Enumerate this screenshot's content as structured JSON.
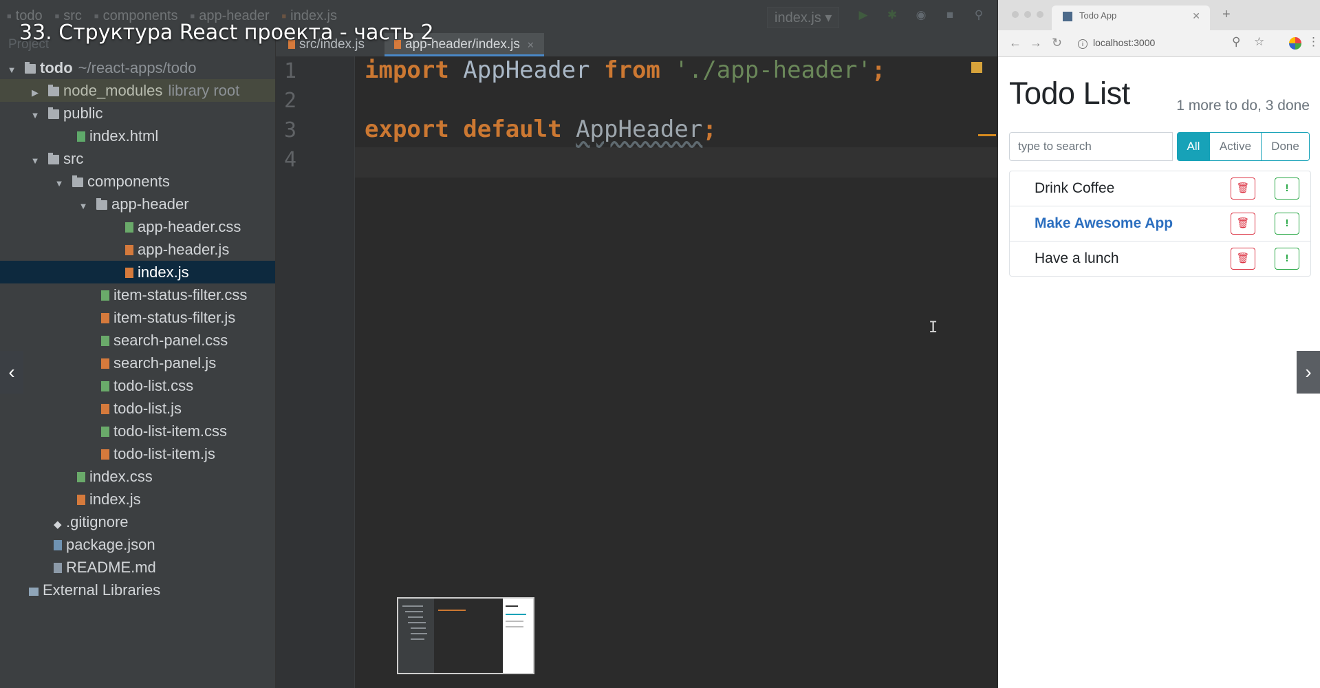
{
  "video": {
    "title": "33. Структура React проекта - часть 2"
  },
  "ide": {
    "breadcrumbs": [
      "todo",
      "src",
      "components",
      "app-header",
      "index.js"
    ],
    "run_config": "index.js ▾",
    "toolbar_icons": [
      "run-icon",
      "debug-icon",
      "coverage-icon",
      "stop-icon",
      "search-icon"
    ],
    "project_panel_title": "Project",
    "tree": [
      {
        "label": "todo",
        "hint": "~/react-apps/todo",
        "icon": "folder-icon"
      },
      {
        "label": "node_modules",
        "hint": "library root",
        "icon": "folder-icon"
      },
      {
        "label": "public",
        "icon": "folder-icon"
      },
      {
        "label": "index.html",
        "icon": "html-file-icon"
      },
      {
        "label": "src",
        "icon": "folder-icon"
      },
      {
        "label": "components",
        "icon": "folder-icon"
      },
      {
        "label": "app-header",
        "icon": "folder-icon"
      },
      {
        "label": "app-header.css",
        "icon": "css-file-icon"
      },
      {
        "label": "app-header.js",
        "icon": "js-file-icon"
      },
      {
        "label": "index.js",
        "icon": "js-file-icon",
        "selected": true
      },
      {
        "label": "item-status-filter.css",
        "icon": "css-file-icon"
      },
      {
        "label": "item-status-filter.js",
        "icon": "js-file-icon"
      },
      {
        "label": "search-panel.css",
        "icon": "css-file-icon"
      },
      {
        "label": "search-panel.js",
        "icon": "js-file-icon"
      },
      {
        "label": "todo-list.css",
        "icon": "css-file-icon"
      },
      {
        "label": "todo-list.js",
        "icon": "js-file-icon"
      },
      {
        "label": "todo-list-item.css",
        "icon": "css-file-icon"
      },
      {
        "label": "todo-list-item.js",
        "icon": "js-file-icon"
      },
      {
        "label": "index.css",
        "icon": "css-file-icon"
      },
      {
        "label": "index.js",
        "icon": "js-file-icon"
      },
      {
        "label": ".gitignore",
        "icon": "gitignore-icon"
      },
      {
        "label": "package.json",
        "icon": "json-file-icon"
      },
      {
        "label": "README.md",
        "icon": "md-file-icon"
      },
      {
        "label": "External Libraries",
        "icon": "external-libraries-icon"
      }
    ],
    "tabs": [
      {
        "label": "src/index.js",
        "active": false
      },
      {
        "label": "app-header/index.js",
        "active": true
      }
    ],
    "line_numbers": [
      "1",
      "2",
      "3",
      "4"
    ],
    "code": {
      "line1": {
        "kw1": "import",
        "name": " AppHeader ",
        "kw2": "from",
        "str": " './app-header'",
        "semi": ";"
      },
      "line3": {
        "kw1": "export",
        "kw2": " default",
        "name": "AppHeader",
        "semi": ";"
      }
    }
  },
  "browser": {
    "tab_title": "Todo App",
    "url": "localhost:3000",
    "app": {
      "title": "Todo List",
      "count": "1 more to do, 3 done",
      "search_placeholder": "type to search",
      "filters": [
        {
          "label": "All",
          "active": true
        },
        {
          "label": "Active",
          "active": false
        },
        {
          "label": "Done",
          "active": false
        }
      ],
      "items": [
        {
          "label": "Drink Coffee",
          "important": false
        },
        {
          "label": "Make Awesome App",
          "important": true
        },
        {
          "label": "Have a lunch",
          "important": false
        }
      ],
      "delete_icon": "trash-icon",
      "important_icon": "exclamation-icon"
    }
  },
  "slideshow": {
    "prev": "‹",
    "next": "›"
  }
}
